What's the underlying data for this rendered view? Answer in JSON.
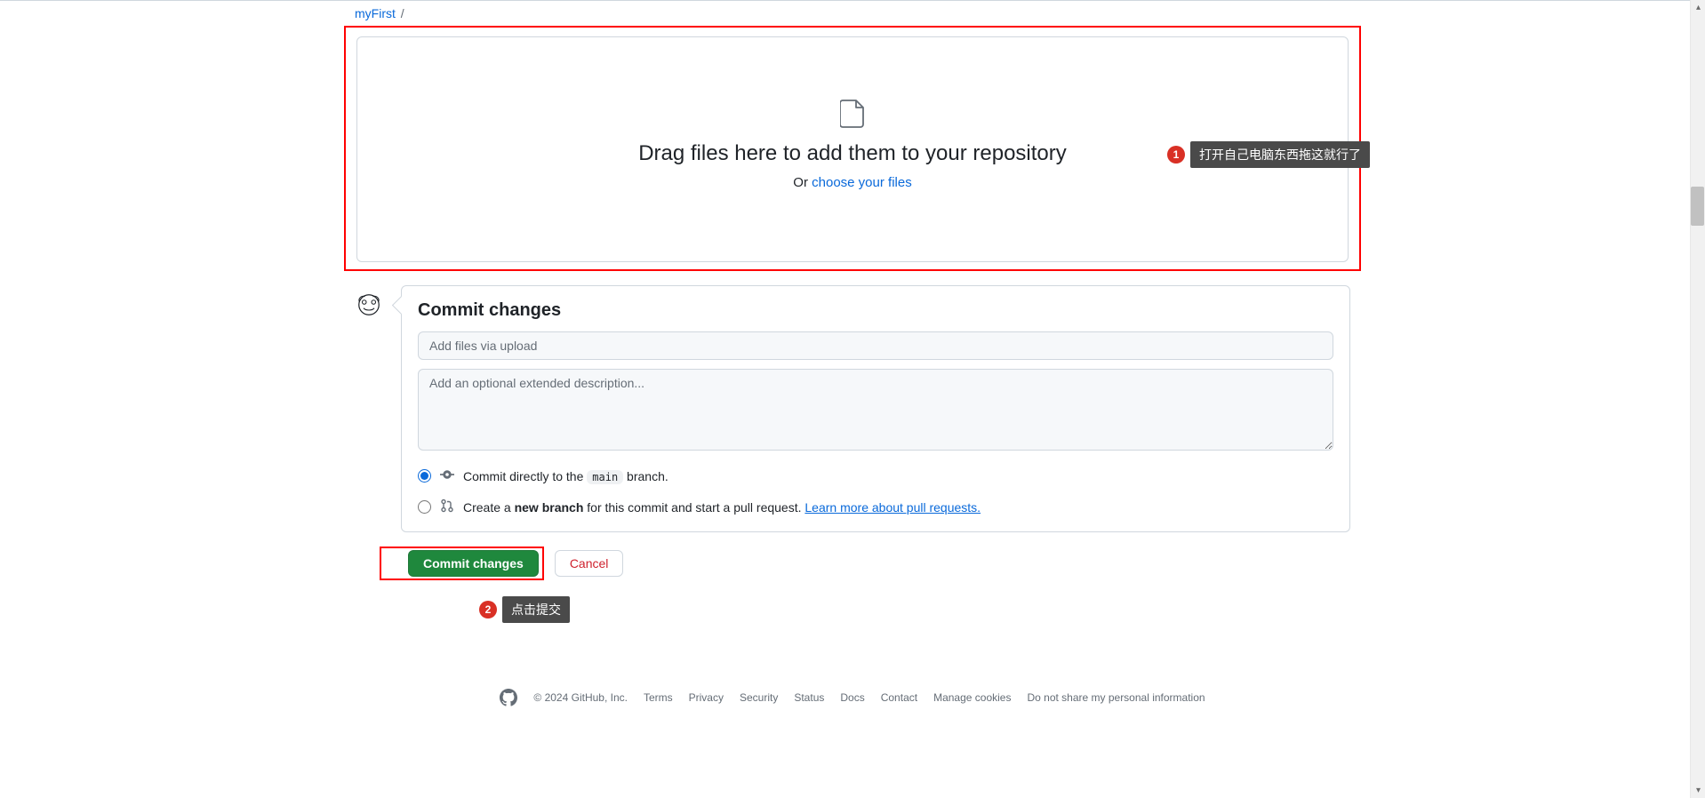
{
  "breadcrumb": {
    "repo": "myFirst",
    "sep": "/"
  },
  "dropzone": {
    "heading": "Drag files here to add them to your repository",
    "or": "Or ",
    "choose": "choose your files"
  },
  "commit": {
    "heading": "Commit changes",
    "summary_placeholder": "Add files via upload",
    "description_placeholder": "Add an optional extended description...",
    "radio_direct_pre": "Commit directly to the ",
    "radio_direct_branch": "main",
    "radio_direct_post": " branch.",
    "radio_newbranch_pre": "Create a ",
    "radio_newbranch_strong": "new branch",
    "radio_newbranch_post": " for this commit and start a pull request. ",
    "radio_newbranch_link": "Learn more about pull requests.",
    "btn_commit": "Commit changes",
    "btn_cancel": "Cancel"
  },
  "annotations": {
    "a1_num": "1",
    "a1_text": "打开自己电脑东西拖这就行了",
    "a2_num": "2",
    "a2_text": "点击提交"
  },
  "footer": {
    "copyright": "© 2024 GitHub, Inc.",
    "links": [
      "Terms",
      "Privacy",
      "Security",
      "Status",
      "Docs",
      "Contact",
      "Manage cookies",
      "Do not share my personal information"
    ]
  }
}
